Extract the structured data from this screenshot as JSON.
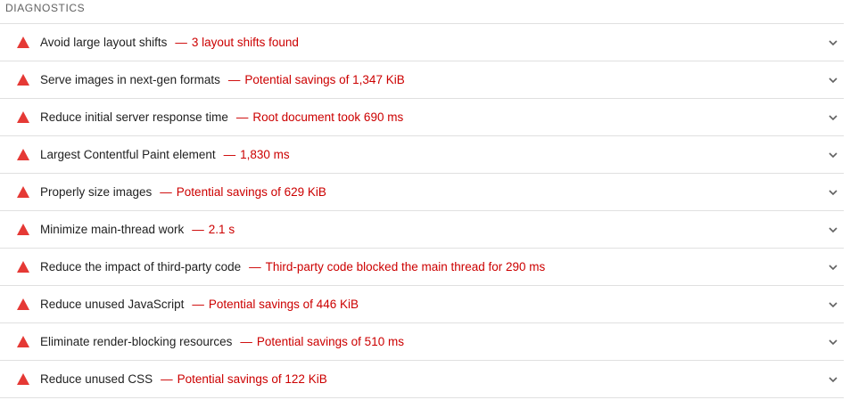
{
  "section": {
    "title": "DIAGNOSTICS"
  },
  "colors": {
    "fail": "#e53935",
    "value": "#cc0000",
    "divider": "#e0e0e0"
  },
  "icons": {
    "status": "fail-triangle-icon",
    "expand": "chevron-down-icon"
  },
  "audits": [
    {
      "title": "Avoid large layout shifts",
      "separator": "—",
      "value": "3 layout shifts found"
    },
    {
      "title": "Serve images in next-gen formats",
      "separator": "—",
      "value": "Potential savings of 1,347 KiB"
    },
    {
      "title": "Reduce initial server response time",
      "separator": "—",
      "value": "Root document took 690 ms"
    },
    {
      "title": "Largest Contentful Paint element",
      "separator": "—",
      "value": "1,830 ms"
    },
    {
      "title": "Properly size images",
      "separator": "—",
      "value": "Potential savings of 629 KiB"
    },
    {
      "title": "Minimize main-thread work",
      "separator": "—",
      "value": "2.1 s"
    },
    {
      "title": "Reduce the impact of third-party code",
      "separator": "—",
      "value": "Third-party code blocked the main thread for 290 ms"
    },
    {
      "title": "Reduce unused JavaScript",
      "separator": "—",
      "value": "Potential savings of 446 KiB"
    },
    {
      "title": "Eliminate render-blocking resources",
      "separator": "—",
      "value": "Potential savings of 510 ms"
    },
    {
      "title": "Reduce unused CSS",
      "separator": "—",
      "value": "Potential savings of 122 KiB"
    }
  ]
}
